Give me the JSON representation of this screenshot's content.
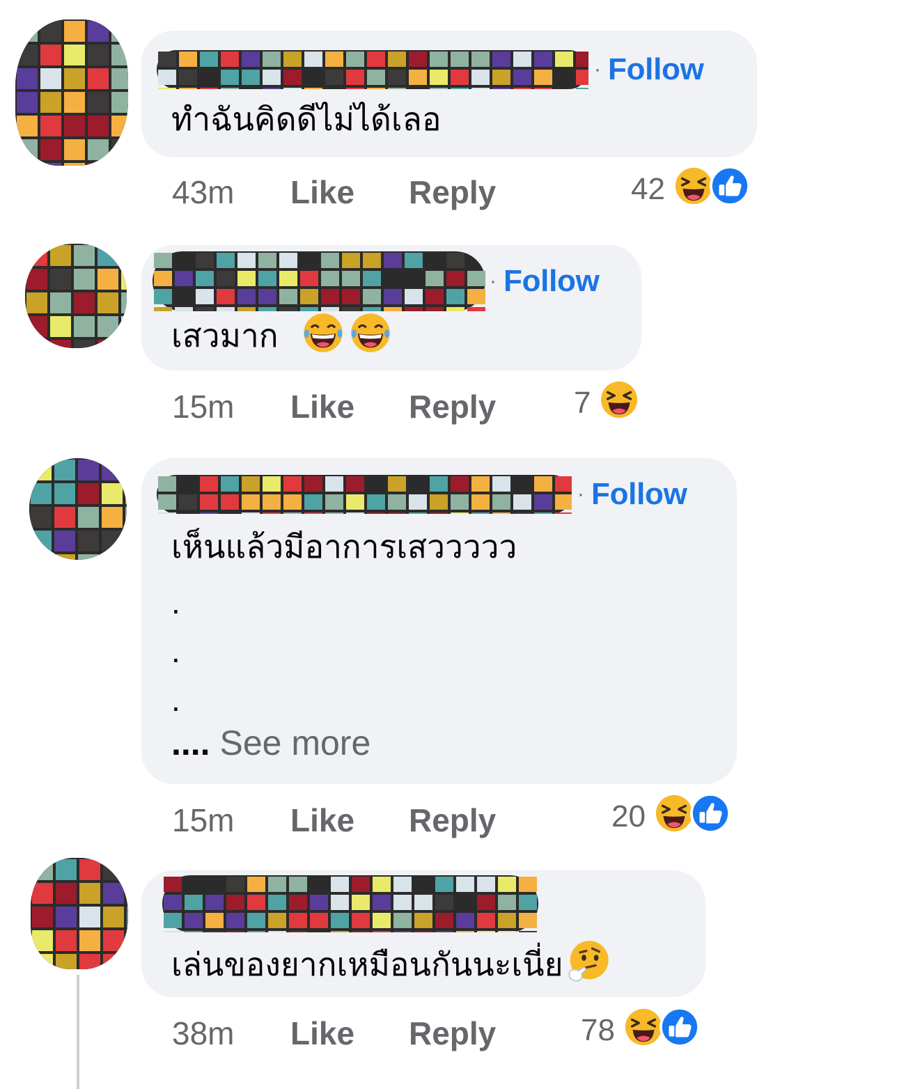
{
  "comments": [
    {
      "follow_label": "Follow",
      "separator": "·",
      "text": "ทำฉันคิดดีไม่ได้เลอ",
      "time": "43m",
      "like_label": "Like",
      "reply_label": "Reply",
      "reaction_count": "42",
      "reactions": [
        "haha-icon",
        "like-icon"
      ]
    },
    {
      "follow_label": "Follow",
      "separator": "·",
      "text": "เสวมาก",
      "text_emojis": [
        "tears-of-joy-emoji",
        "tears-of-joy-emoji"
      ],
      "time": "15m",
      "like_label": "Like",
      "reply_label": "Reply",
      "reaction_count": "7",
      "reactions": [
        "haha-icon"
      ]
    },
    {
      "follow_label": "Follow",
      "separator": "·",
      "text": "เห็นแล้วมีอาการเสววววว",
      "dots": [
        ".",
        ".",
        "."
      ],
      "see_more_lead": "....",
      "see_more_label": "See more",
      "time": "15m",
      "like_label": "Like",
      "reply_label": "Reply",
      "reaction_count": "20",
      "reactions": [
        "haha-icon",
        "like-icon"
      ]
    },
    {
      "text": "เล่นของยากเหมือนกันนะเนี่ย",
      "text_emojis": [
        "thinking-face-emoji"
      ],
      "time": "38m",
      "like_label": "Like",
      "reply_label": "Reply",
      "reaction_count": "78",
      "reactions": [
        "haha-icon",
        "like-icon"
      ]
    }
  ],
  "colors": {
    "bubble": "#f0f2f5",
    "follow": "#1b74e4",
    "meta": "#65676b",
    "text": "#050505",
    "mosaic": [
      "#e03a3e",
      "#f5b042",
      "#5a3d9a",
      "#4fa3a5",
      "#8fb3a0",
      "#3d3a3a",
      "#c9a227",
      "#d8e3ea",
      "#eaea6a",
      "#9c1c2c"
    ]
  }
}
